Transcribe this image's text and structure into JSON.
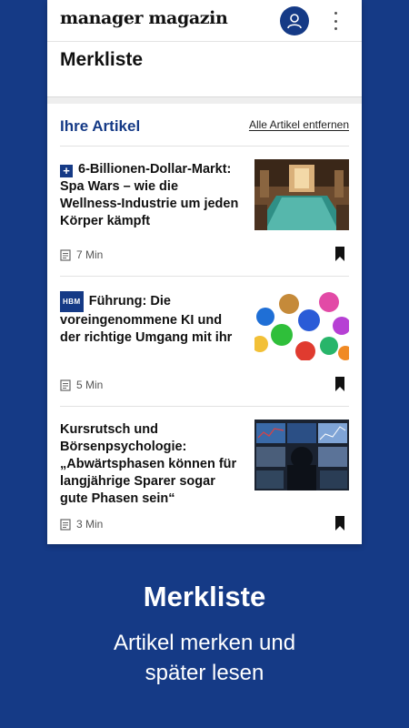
{
  "app": {
    "logo": "manager magazin",
    "page_title": "Merkliste"
  },
  "section": {
    "title": "Ihre Artikel",
    "remove_all_label": "Alle Artikel entfernen"
  },
  "articles": [
    {
      "badge": "plus",
      "title": "6-Billionen-Dollar-Markt: Spa Wars – wie die Wellness-Industrie um jeden Körper kämpft",
      "read_time": "7 Min",
      "image": "spa-pool-image"
    },
    {
      "badge": "HBM",
      "title": "Führung: Die voreingenommene KI und der richtige Umgang mit ihr",
      "read_time": "5 Min",
      "image": "colorful-heads-image"
    },
    {
      "badge": "",
      "title": "Kursrutsch und Börsenpsychologie: „Abwärtsphasen können für langjährige Sparer sogar gute Phasen sein“",
      "read_time": "3 Min",
      "image": "trading-screens-image"
    }
  ],
  "promo": {
    "title": "Merkliste",
    "subtitle_line1": "Artikel merken und",
    "subtitle_line2": "später lesen"
  },
  "colors": {
    "brand_blue": "#153a86",
    "background": "#153a86"
  }
}
